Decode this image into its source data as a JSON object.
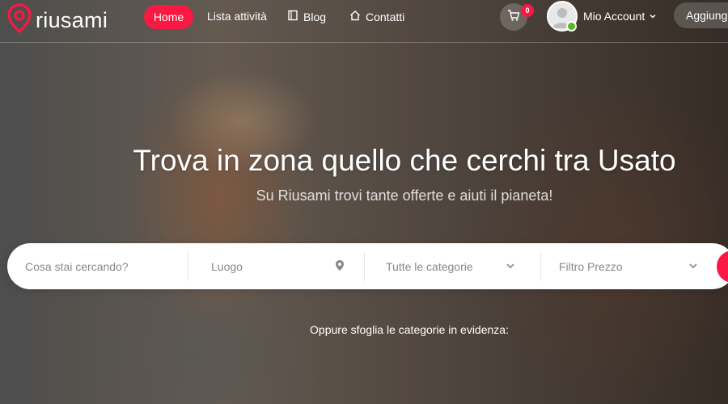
{
  "brand": {
    "name": "riusami",
    "accent_color": "#f91942"
  },
  "nav": {
    "home": "Home",
    "listings": "Lista attività",
    "blog": "Blog",
    "contacts": "Contatti",
    "blog_icon": "book-icon",
    "contacts_icon": "home-icon"
  },
  "header": {
    "cart_count": "0",
    "cart_icon": "cart-icon",
    "account_label": "Mio Account",
    "add_button": "Aggiungi"
  },
  "hero": {
    "title": "Trova in zona quello che cerchi tra Usato",
    "subtitle": "Su Riusami trovi tante offerte e aiuti il pianeta!"
  },
  "search": {
    "query_placeholder": "Cosa stai cercando?",
    "location_placeholder": "Luogo",
    "category_value": "Tutte le categorie",
    "price_value": "Filtro Prezzo",
    "location_icon": "map-pin-icon",
    "search_icon": "search-icon"
  },
  "browse": {
    "text": "Oppure sfoglia le categorie in evidenza:"
  }
}
